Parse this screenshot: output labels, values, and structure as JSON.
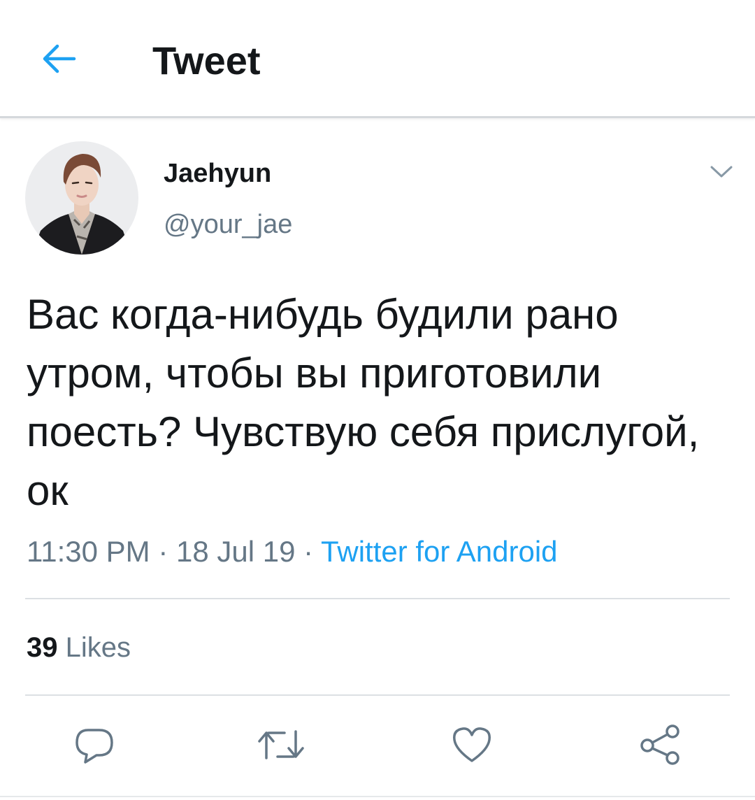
{
  "header": {
    "title": "Tweet",
    "back_icon": "arrow-left-icon"
  },
  "tweet": {
    "author": {
      "display_name": "Jaehyun",
      "handle": "@your_jae"
    },
    "text": "Вас когда-нибудь будили рано утром, чтобы вы приготовили поесть? Чувствую себя прислугой, ок",
    "time": "11:30 PM",
    "separator": " · ",
    "date": "18 Jul 19",
    "source": "Twitter for Android",
    "likes": {
      "count": "39",
      "label": "Likes"
    }
  },
  "actions": {
    "reply_icon": "reply-icon",
    "retweet_icon": "retweet-icon",
    "like_icon": "heart-icon",
    "share_icon": "share-icon"
  },
  "colors": {
    "accent": "#1da1f2",
    "text_primary": "#14171a",
    "text_secondary": "#657786",
    "divider": "#dce0e3"
  }
}
